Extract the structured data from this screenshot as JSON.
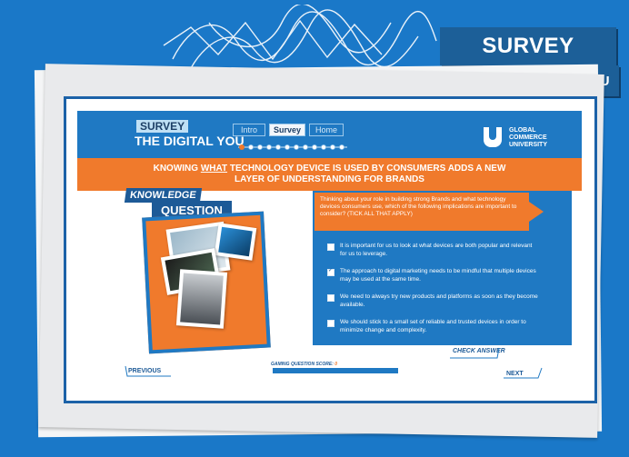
{
  "banner": {
    "title": "SURVEY",
    "subtitle": "THE DIGITAL YOU"
  },
  "header": {
    "logo_line1": "SURVEY",
    "logo_line2": "THE DIGITAL YOU",
    "tabs": [
      {
        "label": "Intro"
      },
      {
        "label": "Survey"
      },
      {
        "label": "Home"
      }
    ],
    "active_tab": "Survey",
    "brand": {
      "line1": "GLOBAL",
      "line2": "COMMERCE",
      "line3": "UNIVERSITY"
    }
  },
  "headline": {
    "before": "KNOWING ",
    "highlight": "WHAT",
    "after": " TECHNOLOGY DEVICE IS USED BY CONSUMERS ADDS A NEW LAYER OF UNDERSTANDING FOR BRANDS"
  },
  "knowledge": {
    "label1": "KNOWLEDGE",
    "label2": "QUESTION"
  },
  "question": "Thinking about your role in building strong Brands and what technology devices consumers use, which of the following implications are important to consider? (TICK ALL THAT APPLY)",
  "options": [
    {
      "text": "It is important for us to look at what devices are both popular and relevant for us to leverage.",
      "checked": false
    },
    {
      "text": "The approach to digital marketing needs to be mindful that multiple devices may be used at the same time.",
      "checked": true
    },
    {
      "text": "We need to always try new products and platforms as soon as they become available.",
      "checked": false
    },
    {
      "text": "We should stick to a small set of reliable and trusted devices in order to minimize change and complexity.",
      "checked": false
    }
  ],
  "buttons": {
    "check": "CHECK ANSWER",
    "previous": "PREVIOUS",
    "next": "NEXT"
  },
  "score_label": "GAMING QUESTION SCORE:",
  "score_value": "0",
  "colors": {
    "blue": "#1f79c3",
    "orange": "#f07a2c",
    "navy": "#1d5a97"
  }
}
